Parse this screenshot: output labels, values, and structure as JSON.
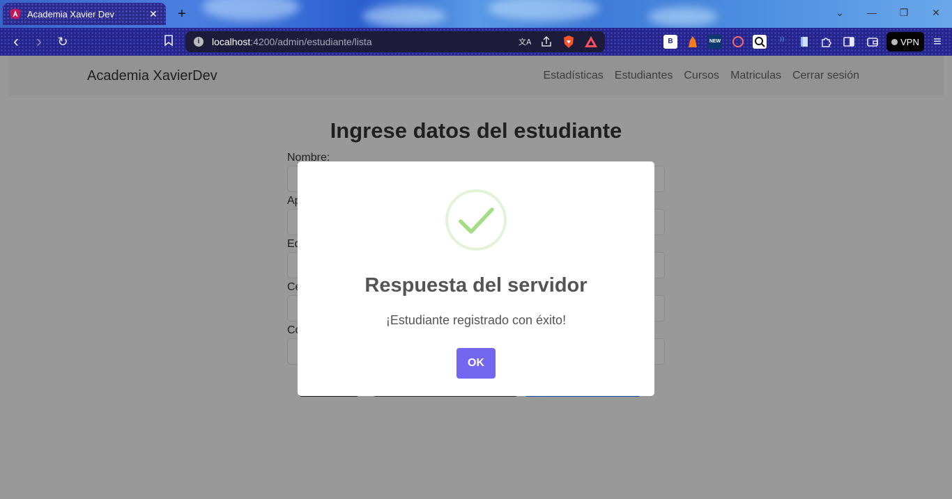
{
  "browser": {
    "tab_title": "Academia Xavier Dev",
    "tab_close": "✕",
    "new_tab": "+",
    "url_host": "localhost",
    "url_path": ":4200/admin/estudiante/lista",
    "vpn_label": "VPN",
    "window_controls": {
      "dropdown": "⌄",
      "minimize": "—",
      "restore": "❐",
      "close": "✕"
    },
    "nav_icons": {
      "back": "‹",
      "forward": "›",
      "reload": "↻",
      "bookmark": "🔖",
      "menu": "≡"
    }
  },
  "navbar": {
    "brand": "Academia XavierDev",
    "links": [
      "Estadísticas",
      "Estudiantes",
      "Cursos",
      "Matriculas",
      "Cerrar sesión"
    ]
  },
  "form": {
    "heading": "Ingrese datos del estudiante",
    "labels": [
      "Nombre:",
      "Ap",
      "Ed",
      "Ce",
      "Co"
    ]
  },
  "modal": {
    "title": "Respuesta del servidor",
    "message": "¡Estudiante registrado con éxito!",
    "ok_label": "OK",
    "icon": "success-check-icon"
  },
  "colors": {
    "accent": "#7367f0",
    "success": "#a5dc86",
    "overlay": "#999999"
  }
}
